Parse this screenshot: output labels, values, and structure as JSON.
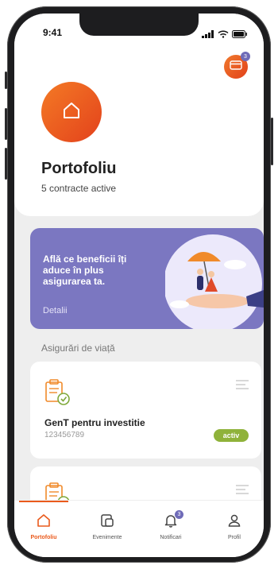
{
  "status_bar": {
    "time": "9:41"
  },
  "header": {
    "wallet_badge": "3",
    "title": "Portofoliu",
    "subtitle": "5 contracte active"
  },
  "banner": {
    "text": "Află ce beneficii îți aduce în plus asigurarea ta.",
    "link": "Detalii"
  },
  "section": {
    "label": "Asigurări de viață"
  },
  "policies": [
    {
      "name": "GenT pentru  investitie",
      "number": "123456789",
      "status": "activ"
    }
  ],
  "tabbar": {
    "items": [
      {
        "label": "Portofoliu",
        "icon": "home-icon"
      },
      {
        "label": "Evenimente",
        "icon": "document-icon"
      },
      {
        "label": "Notificari",
        "icon": "bell-icon",
        "badge": "3"
      },
      {
        "label": "Profil",
        "icon": "user-icon"
      }
    ]
  },
  "colors": {
    "brand_orange": "#ea5a1c",
    "banner_purple": "#7b77c1",
    "active_green": "#8fb23a"
  }
}
